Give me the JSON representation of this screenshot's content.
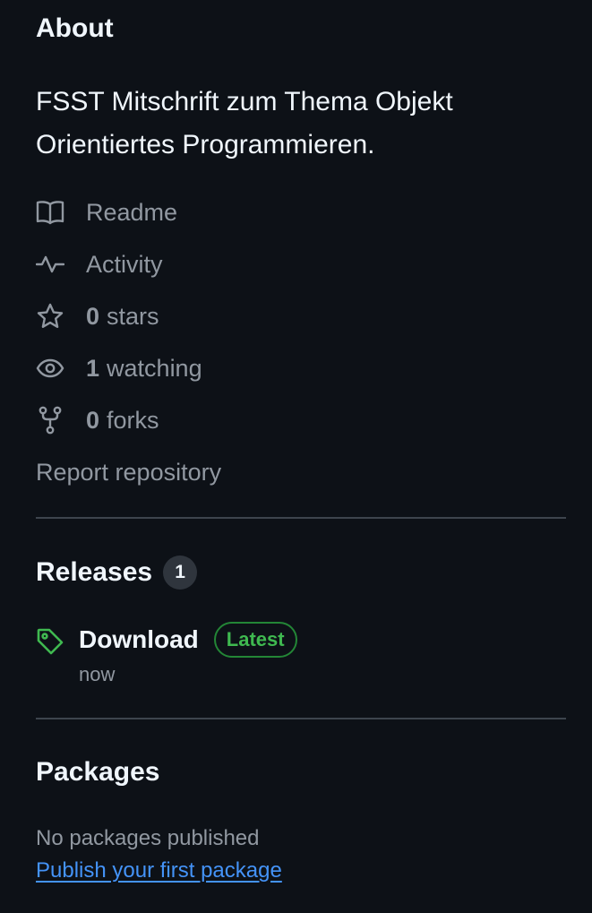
{
  "about": {
    "title": "About",
    "description": "FSST Mitschrift zum Thema Objekt Orientiertes Programmieren.",
    "stats": {
      "readme_label": "Readme",
      "activity_label": "Activity",
      "stars_count": "0",
      "stars_label": "stars",
      "watching_count": "1",
      "watching_label": "watching",
      "forks_count": "0",
      "forks_label": "forks"
    },
    "report_label": "Report repository"
  },
  "releases": {
    "title": "Releases",
    "count": "1",
    "latest": {
      "name": "Download",
      "badge": "Latest",
      "time": "now"
    }
  },
  "packages": {
    "title": "Packages",
    "empty_text": "No packages published",
    "publish_link": "Publish your first package"
  },
  "colors": {
    "background": "#0d1117",
    "text_primary": "#f0f6fc",
    "text_muted": "#9198a1",
    "link": "#4493f8",
    "success": "#3fb950",
    "divider": "#3d444d"
  },
  "icons": {
    "readme": "book-icon",
    "activity": "pulse-icon",
    "stars": "star-icon",
    "watching": "eye-icon",
    "forks": "fork-icon",
    "release": "tag-icon"
  }
}
